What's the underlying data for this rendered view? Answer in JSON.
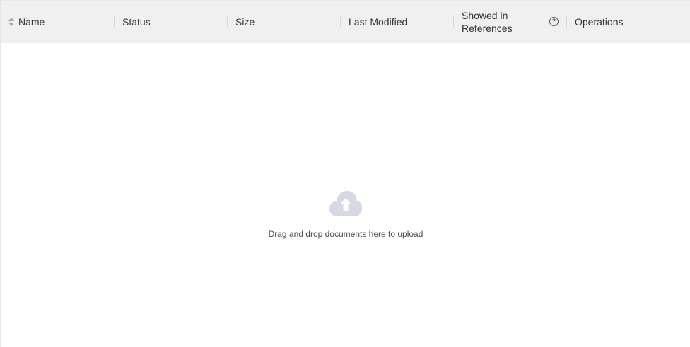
{
  "table": {
    "columns": [
      {
        "label": "Name",
        "sortable": true
      },
      {
        "label": "Status"
      },
      {
        "label": "Size"
      },
      {
        "label": "Last Modified"
      },
      {
        "label_line1": "Showed in",
        "label_line2": "References",
        "has_help": true
      },
      {
        "label": "Operations"
      }
    ],
    "help_glyph": "?",
    "icons": {
      "sort": "sort-icon",
      "help": "question-circle-icon"
    }
  },
  "empty_state": {
    "icon": "cloud-upload-icon",
    "message": "Drag and drop documents here to upload"
  },
  "colors": {
    "header_bg": "#f0f0f0",
    "icon_gray": "#d6d9e3",
    "text": "#333333"
  }
}
